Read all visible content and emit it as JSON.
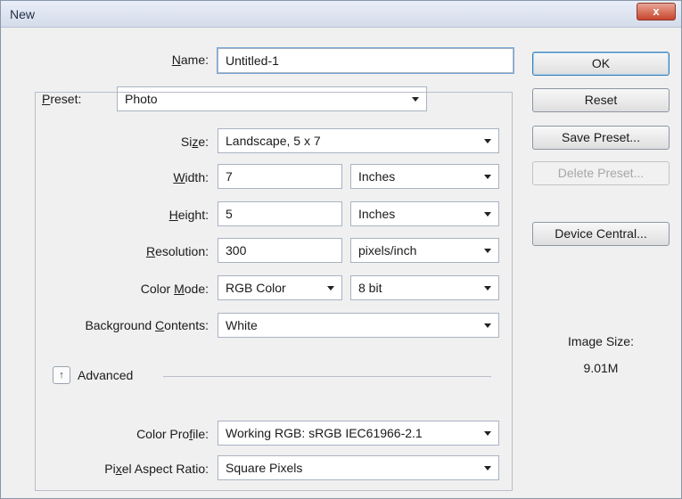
{
  "dialog": {
    "title": "New",
    "close_label": "x"
  },
  "name": {
    "label": "Name:",
    "value": "Untitled-1"
  },
  "preset": {
    "label": "Preset:",
    "value": "Photo"
  },
  "size": {
    "label": "Size:",
    "value": "Landscape, 5 x 7"
  },
  "width": {
    "label": "Width:",
    "value": "7",
    "unit": "Inches"
  },
  "height": {
    "label": "Height:",
    "value": "5",
    "unit": "Inches"
  },
  "resolution": {
    "label": "Resolution:",
    "value": "300",
    "unit": "pixels/inch"
  },
  "color_mode": {
    "label": "Color Mode:",
    "value": "RGB Color",
    "depth": "8 bit"
  },
  "background_contents": {
    "label": "Background Contents:",
    "value": "White"
  },
  "advanced": {
    "label": "Advanced",
    "toggle_glyph": "↑"
  },
  "color_profile": {
    "label": "Color Profile:",
    "value": "Working RGB:  sRGB IEC61966-2.1"
  },
  "pixel_aspect_ratio": {
    "label": "Pixel Aspect Ratio:",
    "value": "Square Pixels"
  },
  "buttons": {
    "ok": "OK",
    "reset": "Reset",
    "save_preset": "Save Preset...",
    "delete_preset": "Delete Preset...",
    "device_central": "Device Central..."
  },
  "image_size": {
    "label": "Image Size:",
    "value": "9.01M"
  }
}
